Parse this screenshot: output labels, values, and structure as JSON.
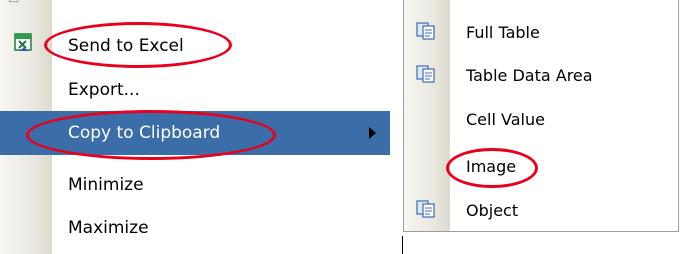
{
  "main_menu": {
    "items": [
      {
        "label": "Send to Excel",
        "icon": "excel-icon"
      },
      {
        "label": "Export..."
      },
      {
        "label": "Copy to Clipboard",
        "has_submenu": true,
        "selected": true
      },
      {
        "label": "Minimize"
      },
      {
        "label": "Maximize"
      }
    ]
  },
  "submenu": {
    "items": [
      {
        "label": "Full Table",
        "icon": "copy-icon"
      },
      {
        "label": "Table Data Area",
        "icon": "copy-icon"
      },
      {
        "label": "Cell Value"
      },
      {
        "label": "Image"
      },
      {
        "label": "Object",
        "icon": "copy-icon"
      }
    ]
  },
  "colors": {
    "selected_bg": "#3b6ea8",
    "annotation": "#e8001c"
  }
}
